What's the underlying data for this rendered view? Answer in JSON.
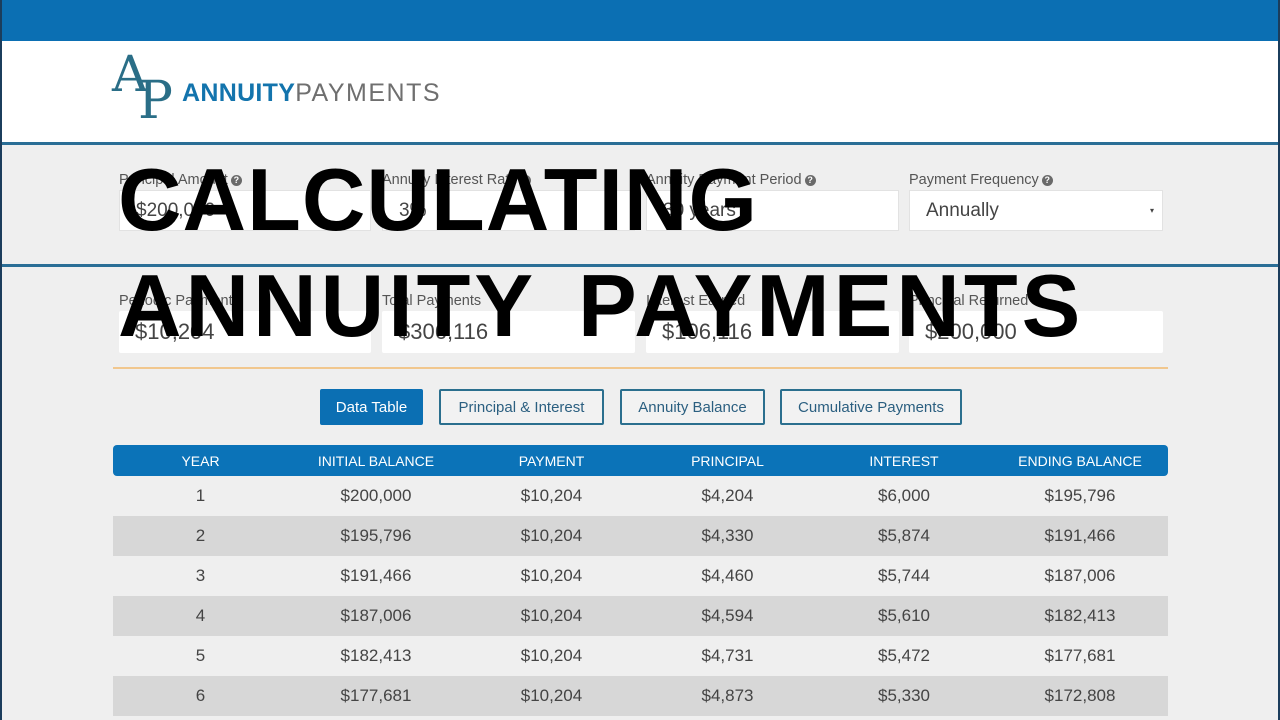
{
  "brand": {
    "mark_letter_1": "A",
    "mark_letter_2": "P",
    "name_strong": "ANNUITY",
    "name_light": "PAYMENTS",
    "primary_color": "#0b6fb3",
    "accent_rule_color": "#f1c78e"
  },
  "inputs": {
    "principal": {
      "label": "Principal Amount",
      "value": "$200,000",
      "help_icon": "question-circle-icon"
    },
    "rate": {
      "label": "Annuity Interest Rate",
      "value": "3%",
      "help_icon": "question-circle-icon"
    },
    "period": {
      "label": "Annuity Payment Period",
      "value": "30 years",
      "help_icon": "question-circle-icon"
    },
    "frequency": {
      "label": "Payment Frequency",
      "value": "Annually",
      "caret": "▾",
      "help_icon": "question-circle-icon"
    }
  },
  "help_glyph": "?",
  "results": {
    "periodic_payment": {
      "label": "Periodic Payment",
      "value": "$10,204"
    },
    "total_payments": {
      "label": "Total Payments",
      "value": "$306,116"
    },
    "interest_earned": {
      "label": "Interest Earned",
      "value": "$106,116"
    },
    "principal_returned": {
      "label": "Principal Returned",
      "value": "$200,000"
    }
  },
  "tabs": [
    {
      "label": "Data Table",
      "active": true
    },
    {
      "label": "Principal & Interest",
      "active": false
    },
    {
      "label": "Annuity Balance",
      "active": false
    },
    {
      "label": "Cumulative Payments",
      "active": false
    }
  ],
  "table": {
    "headers": [
      "YEAR",
      "INITIAL BALANCE",
      "PAYMENT",
      "PRINCIPAL",
      "INTEREST",
      "ENDING BALANCE"
    ],
    "rows": [
      [
        "1",
        "$200,000",
        "$10,204",
        "$4,204",
        "$6,000",
        "$195,796"
      ],
      [
        "2",
        "$195,796",
        "$10,204",
        "$4,330",
        "$5,874",
        "$191,466"
      ],
      [
        "3",
        "$191,466",
        "$10,204",
        "$4,460",
        "$5,744",
        "$187,006"
      ],
      [
        "4",
        "$187,006",
        "$10,204",
        "$4,594",
        "$5,610",
        "$182,413"
      ],
      [
        "5",
        "$182,413",
        "$10,204",
        "$4,731",
        "$5,472",
        "$177,681"
      ],
      [
        "6",
        "$177,681",
        "$10,204",
        "$4,873",
        "$5,330",
        "$172,808"
      ]
    ]
  },
  "overlay": {
    "line1": "CALCULATING",
    "line2": "ANNUITY PAYMENTS"
  }
}
